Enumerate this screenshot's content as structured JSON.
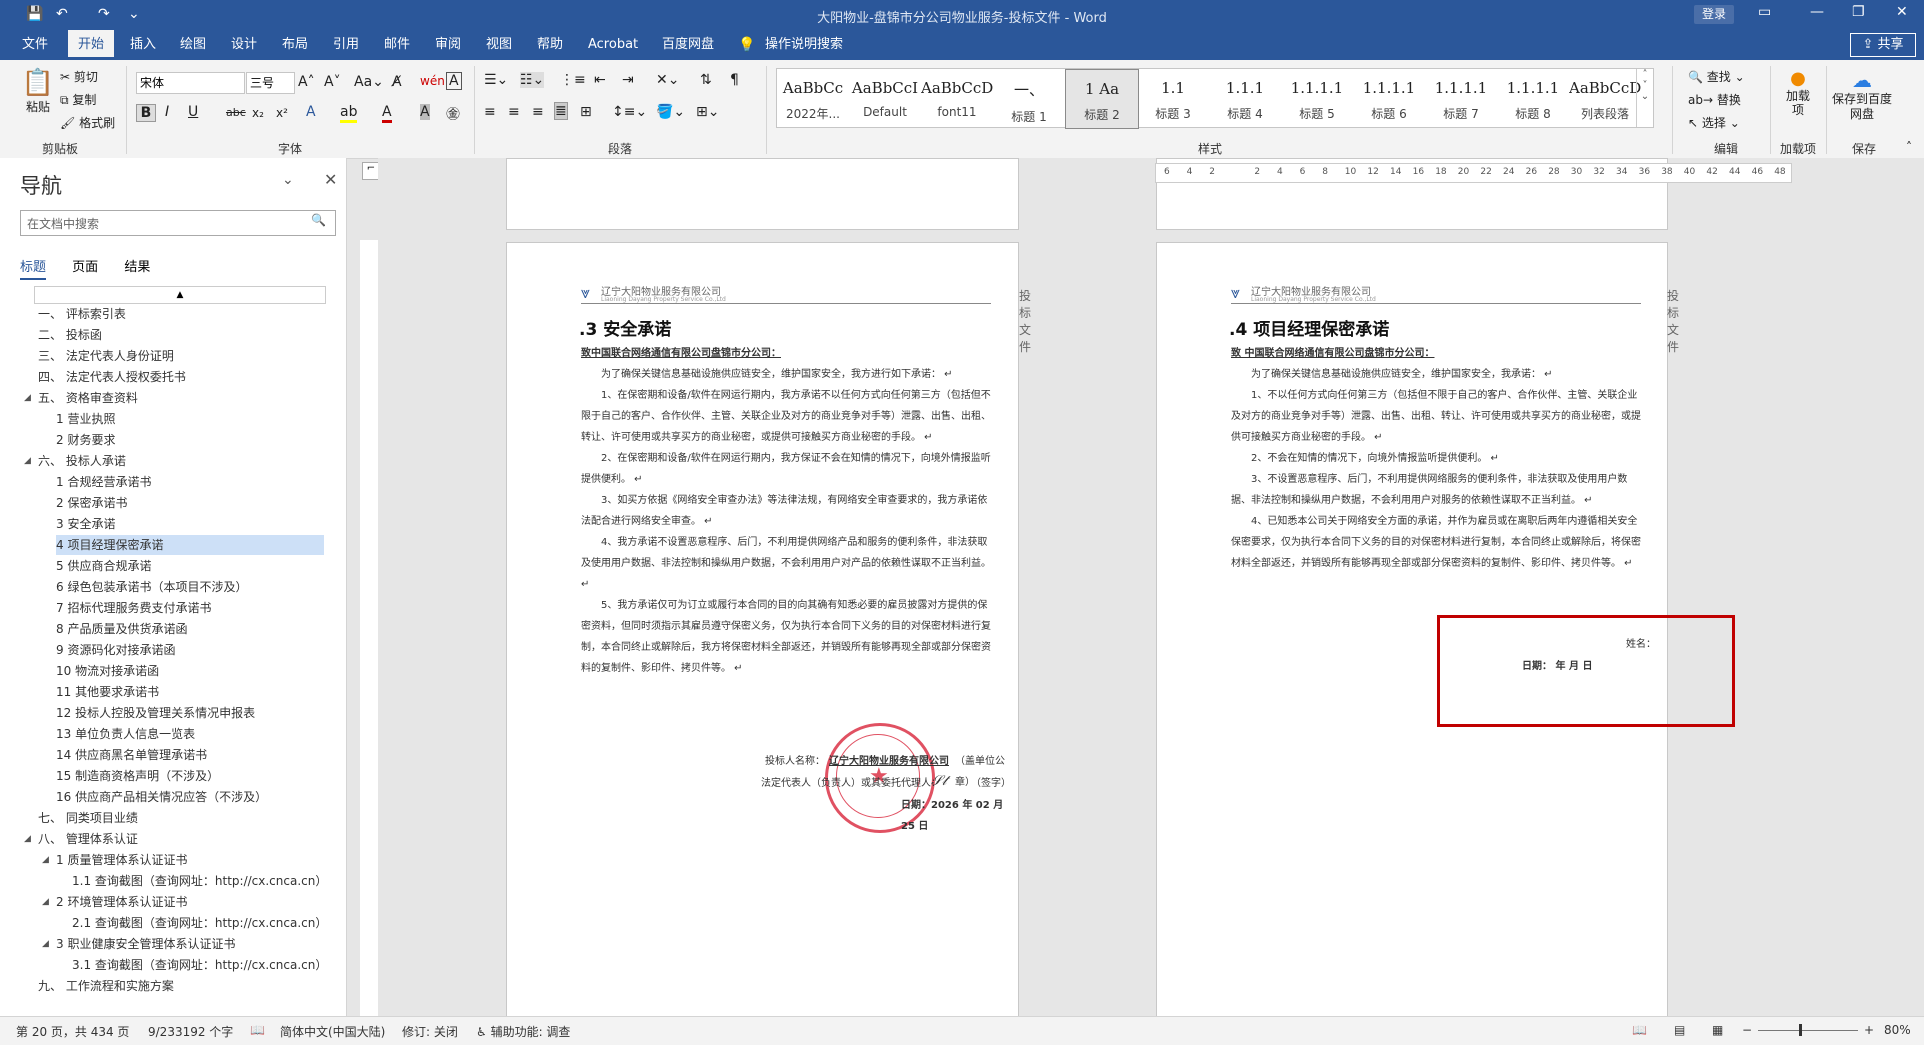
{
  "window": {
    "title": "大阳物业-盘锦市分公司物业服务-投标文件 - Word",
    "login": "登录",
    "share": "共享"
  },
  "menu_tabs": [
    "文件",
    "开始",
    "插入",
    "绘图",
    "设计",
    "布局",
    "引用",
    "邮件",
    "审阅",
    "视图",
    "帮助",
    "Acrobat",
    "百度网盘",
    "操作说明搜索"
  ],
  "ribbon": {
    "clipboard": {
      "paste": "粘贴",
      "cut": "剪切",
      "copy": "复制",
      "format_painter": "格式刷",
      "label": "剪贴板"
    },
    "font": {
      "name": "宋体",
      "size": "三号",
      "label": "字体",
      "bold": "B",
      "italic": "I",
      "underline": "U",
      "strike": "abc",
      "sub": "x₂",
      "sup": "x²"
    },
    "paragraph": {
      "label": "段落"
    },
    "styles": {
      "label": "样式",
      "items": [
        {
          "sample": "AaBbCc",
          "name": "2022年..."
        },
        {
          "sample": "AaBbCcI",
          "name": "Default"
        },
        {
          "sample": "AaBbCcDdI",
          "name": "font11"
        },
        {
          "sample": "一、",
          "name": "标题 1"
        },
        {
          "sample": "1   Aa",
          "name": "标题 2"
        },
        {
          "sample": "1.1",
          "name": "标题 3"
        },
        {
          "sample": "1.1.1",
          "name": "标题 4"
        },
        {
          "sample": "1.1.1.1",
          "name": "标题 5"
        },
        {
          "sample": "1.1.1.1",
          "name": "标题 6"
        },
        {
          "sample": "1.1.1.1",
          "name": "标题 7"
        },
        {
          "sample": "1.1.1.1",
          "name": "标题 8"
        },
        {
          "sample": "AaBbCcDdI",
          "name": "列表段落"
        }
      ]
    },
    "editing": {
      "find": "查找",
      "replace": "替换",
      "select": "选择",
      "label": "编辑"
    },
    "addins": {
      "load": "加载项",
      "label": "加载项"
    },
    "save": {
      "baidu": "保存到百度网盘",
      "label": "保存"
    }
  },
  "nav": {
    "title": "导航",
    "search_placeholder": "在文档中搜索",
    "tabs": [
      "标题",
      "页面",
      "结果"
    ],
    "items": [
      {
        "text": "一、 评标索引表",
        "level": 1,
        "arrow": false
      },
      {
        "text": "二、 投标函",
        "level": 1,
        "arrow": false
      },
      {
        "text": "三、 法定代表人身份证明",
        "level": 1,
        "arrow": false
      },
      {
        "text": "四、 法定代表人授权委托书",
        "level": 1,
        "arrow": false
      },
      {
        "text": "五、 资格审查资料",
        "level": 1,
        "arrow": true
      },
      {
        "text": "1 营业执照",
        "level": 2,
        "arrow": false
      },
      {
        "text": "2 财务要求",
        "level": 2,
        "arrow": false
      },
      {
        "text": "六、 投标人承诺",
        "level": 1,
        "arrow": true
      },
      {
        "text": "1 合规经营承诺书",
        "level": 2,
        "arrow": false
      },
      {
        "text": "2 保密承诺书",
        "level": 2,
        "arrow": false
      },
      {
        "text": "3 安全承诺",
        "level": 2,
        "arrow": false
      },
      {
        "text": "4 项目经理保密承诺",
        "level": 2,
        "arrow": false,
        "selected": true
      },
      {
        "text": "5 供应商合规承诺",
        "level": 2,
        "arrow": false
      },
      {
        "text": "6 绿色包装承诺书（本项目不涉及）",
        "level": 2,
        "arrow": false
      },
      {
        "text": "7 招标代理服务费支付承诺书",
        "level": 2,
        "arrow": false
      },
      {
        "text": "8 产品质量及供货承诺函",
        "level": 2,
        "arrow": false
      },
      {
        "text": "9 资源码化对接承诺函",
        "level": 2,
        "arrow": false
      },
      {
        "text": "10 物流对接承诺函",
        "level": 2,
        "arrow": false
      },
      {
        "text": "11 其他要求承诺书",
        "level": 2,
        "arrow": false
      },
      {
        "text": "12 投标人控股及管理关系情况申报表",
        "level": 2,
        "arrow": false
      },
      {
        "text": "13 单位负责人信息一览表",
        "level": 2,
        "arrow": false
      },
      {
        "text": "14 供应商黑名单管理承诺书",
        "level": 2,
        "arrow": false
      },
      {
        "text": "15 制造商资格声明（不涉及）",
        "level": 2,
        "arrow": false
      },
      {
        "text": "16 供应商产品相关情况应答（不涉及）",
        "level": 2,
        "arrow": false
      },
      {
        "text": "七、 同类项目业绩",
        "level": 1,
        "arrow": false
      },
      {
        "text": "八、 管理体系认证",
        "level": 1,
        "arrow": true
      },
      {
        "text": "1 质量管理体系认证证书",
        "level": 2,
        "arrow": true
      },
      {
        "text": "1.1 查询截图（查询网址：http://cx.cnca.cn）",
        "level": 3,
        "arrow": false
      },
      {
        "text": "2 环境管理体系认证证书",
        "level": 2,
        "arrow": true
      },
      {
        "text": "2.1 查询截图（查询网址：http://cx.cnca.cn）",
        "level": 3,
        "arrow": false
      },
      {
        "text": "3 职业健康安全管理体系认证证书",
        "level": 2,
        "arrow": true
      },
      {
        "text": "3.1 查询截图（查询网址：http://cx.cnca.cn）",
        "level": 3,
        "arrow": false
      },
      {
        "text": "九、 工作流程和实施方案",
        "level": 1,
        "arrow": false
      }
    ]
  },
  "ruler_ticks": [
    "6",
    "4",
    "2",
    "",
    "2",
    "4",
    "6",
    "8",
    "10",
    "12",
    "14",
    "16",
    "18",
    "20",
    "22",
    "24",
    "26",
    "28",
    "30",
    "32",
    "34",
    "36",
    "38",
    "40",
    "42",
    "44",
    "46",
    "48"
  ],
  "page_left": {
    "company": "辽宁大阳物业服务有限公司",
    "header_right": "投标文件",
    "heading": ".3  安全承诺",
    "to": "致中国联合网络通信有限公司盘锦市分公司：",
    "paras": [
      "为了确保关键信息基础设施供应链安全，维护国家安全，我方进行如下承诺：",
      "1、在保密期和设备/软件在网运行期内，我方承诺不以任何方式向任何第三方（包括但不限于自己的客户、合作伙伴、主管、关联企业及对方的商业竞争对手等）泄露、出售、出租、转让、许可使用或共享买方的商业秘密，或提供可接触买方商业秘密的手段。",
      "2、在保密期和设备/软件在网运行期内，我方保证不会在知情的情况下，向境外情报监听提供便利。",
      "3、如买方依据《网络安全审查办法》等法律法规，有网络安全审查要求的，我方承诺依法配合进行网络安全审查。",
      "4、我方承诺不设置恶意程序、后门，不利用提供网络产品和服务的便利条件，非法获取及使用用户数据、非法控制和操纵用户数据，不会利用用户对产品的依赖性谋取不正当利益。",
      "5、我方承诺仅可为订立或履行本合同的目的向其确有知悉必要的雇员披露对方提供的保密资料，但同时须指示其雇员遵守保密义务，仅为执行本合同下义务的目的对保密材料进行复制，本合同终止或解除后，我方将保密材料全部返还，并销毁所有能够再现全部或部分保密资料的复制件、影印件、拷贝件等。"
    ],
    "bidder_label": "投标人名称：",
    "bidder_name": "辽宁大阳物业服务有限公司",
    "bidder_seal": "（盖单位公章）",
    "rep_line": "法定代表人（负责人）或其委托代理人：",
    "rep_sign": "（签字）",
    "date_line": "日期：2026 年 02 月 25 日",
    "stamp_text": "辽宁大阳物业服务有限公司"
  },
  "page_right": {
    "company": "辽宁大阳物业服务有限公司",
    "header_right": "投标文件",
    "heading": ".4  项目经理保密承诺",
    "to": "致 中国联合网络通信有限公司盘锦市分公司：",
    "paras": [
      "为了确保关键信息基础设施供应链安全，维护国家安全，我承诺：",
      "1、不以任何方式向任何第三方（包括但不限于自己的客户、合作伙伴、主管、关联企业及对方的商业竞争对手等）泄露、出售、出租、转让、许可使用或共享买方的商业秘密，或提供可接触买方商业秘密的手段。",
      "2、不会在知情的情况下，向境外情报监听提供便利。",
      "3、不设置恶意程序、后门，不利用提供网络服务的便利条件，非法获取及使用用户数据、非法控制和操纵用户数据，不会利用用户对服务的依赖性谋取不正当利益。",
      "4、已知悉本公司关于网络安全方面的承诺，并作为雇员或在离职后两年内遵循相关安全保密要求，仅为执行本合同下义务的目的对保密材料进行复制，本合同终止或解除后，将保密材料全部返还，并销毁所有能够再现全部或部分保密资料的复制件、影印件、拷贝件等。"
    ],
    "name_label": "姓名：",
    "date_label": "日期：   年   月   日"
  },
  "status": {
    "page": "第 20 页，共 434 页",
    "words": "9/233192 个字",
    "lang": "简体中文(中国大陆)",
    "track": "修订: 关闭",
    "access": "辅助功能: 调查",
    "zoom": "80%"
  },
  "colors": {
    "accent": "#2b579a",
    "highlight_box": "#c00000",
    "stamp": "#d9263c"
  }
}
